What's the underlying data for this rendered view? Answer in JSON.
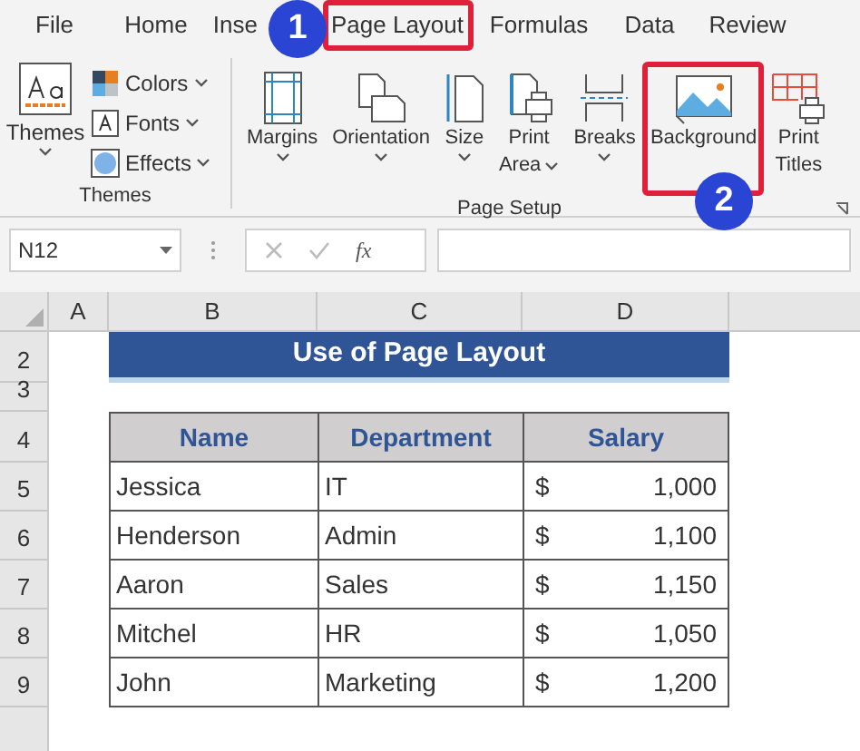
{
  "ribbon_tabs": [
    {
      "label": "File",
      "highlighted": false
    },
    {
      "label": "Home",
      "highlighted": false
    },
    {
      "label": "Inse",
      "highlighted": false
    },
    {
      "label": "Page Layout",
      "highlighted": true
    },
    {
      "label": "Formulas",
      "highlighted": false
    },
    {
      "label": "Data",
      "highlighted": false
    },
    {
      "label": "Review",
      "highlighted": false
    }
  ],
  "themes_group": {
    "label": "Themes",
    "big_button": {
      "label": "Themes",
      "dropdown": true
    },
    "small_buttons": [
      {
        "label": "Colors",
        "dropdown": true
      },
      {
        "label": "Fonts",
        "dropdown": true
      },
      {
        "label": "Effects",
        "dropdown": true
      }
    ]
  },
  "page_setup_group": {
    "label": "Page Setup",
    "buttons": [
      {
        "lines": [
          "Margins"
        ],
        "dropdown": true,
        "highlighted": false
      },
      {
        "lines": [
          "Orientation"
        ],
        "dropdown": true,
        "highlighted": false
      },
      {
        "lines": [
          "Size"
        ],
        "dropdown": true,
        "highlighted": false
      },
      {
        "lines": [
          "Print",
          "Area"
        ],
        "dropdown": true,
        "highlighted": false
      },
      {
        "lines": [
          "Breaks"
        ],
        "dropdown": true,
        "highlighted": false
      },
      {
        "lines": [
          "Background"
        ],
        "dropdown": false,
        "highlighted": true
      },
      {
        "lines": [
          "Print",
          "Titles"
        ],
        "dropdown": false,
        "highlighted": false
      }
    ]
  },
  "annotations": [
    {
      "text": "1"
    },
    {
      "text": "2"
    }
  ],
  "formula_bar": {
    "name_box": "N12",
    "function_label": "fx"
  },
  "sheet": {
    "columns": [
      "A",
      "B",
      "C",
      "D"
    ],
    "row_numbers": [
      "2",
      "3",
      "4",
      "5",
      "6",
      "7",
      "8",
      "9"
    ],
    "title": "Use of Page Layout",
    "table_headers": [
      "Name",
      "Department",
      "Salary"
    ],
    "rows": [
      {
        "name": "Jessica",
        "department": "IT",
        "currency": "$",
        "salary": "1,000"
      },
      {
        "name": "Henderson",
        "department": "Admin",
        "currency": "$",
        "salary": "1,100"
      },
      {
        "name": "Aaron",
        "department": "Sales",
        "currency": "$",
        "salary": "1,150"
      },
      {
        "name": "Mitchel",
        "department": "HR",
        "currency": "$",
        "salary": "1,050"
      },
      {
        "name": "John",
        "department": "Marketing",
        "currency": "$",
        "salary": "1,200"
      }
    ]
  }
}
